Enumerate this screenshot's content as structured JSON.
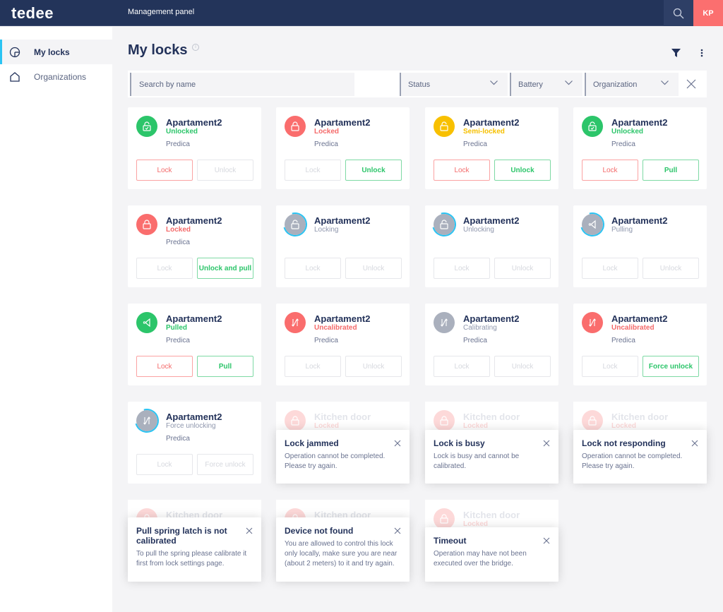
{
  "header": {
    "logo": "tedee",
    "title": "Management panel",
    "avatar_initials": "KP"
  },
  "sidebar": {
    "items": [
      {
        "label": "My locks",
        "icon": "lock-dial-icon",
        "active": true
      },
      {
        "label": "Organizations",
        "icon": "home-icon",
        "active": false
      }
    ]
  },
  "page": {
    "title": "My locks"
  },
  "filters": {
    "search_placeholder": "Search by name",
    "status": "Status",
    "battery": "Battery",
    "organization": "Organization"
  },
  "cards": [
    {
      "name": "Apartament2",
      "status": "Unlocked",
      "org": "Predica",
      "btn1": "Lock",
      "btn2": "Unlock"
    },
    {
      "name": "Apartament2",
      "status": "Locked",
      "org": "Predica",
      "btn1": "Lock",
      "btn2": "Unlock"
    },
    {
      "name": "Apartament2",
      "status": "Semi-locked",
      "org": "Predica",
      "btn1": "Lock",
      "btn2": "Unlock"
    },
    {
      "name": "Apartament2",
      "status": "Unlocked",
      "org": "Predica",
      "btn1": "Lock",
      "btn2": "Pull"
    },
    {
      "name": "Apartament2",
      "status": "Locked",
      "org": "Predica",
      "btn1": "Lock",
      "btn2": "Unlock and pull"
    },
    {
      "name": "Apartament2",
      "status": "Locking",
      "org": "",
      "btn1": "Lock",
      "btn2": "Unlock"
    },
    {
      "name": "Apartament2",
      "status": "Unlocking",
      "org": "",
      "btn1": "Lock",
      "btn2": "Unlock"
    },
    {
      "name": "Apartament2",
      "status": "Pulling",
      "org": "",
      "btn1": "Lock",
      "btn2": "Unlock"
    },
    {
      "name": "Apartament2",
      "status": "Pulled",
      "org": "Predica",
      "btn1": "Lock",
      "btn2": "Pull"
    },
    {
      "name": "Apartament2",
      "status": "Uncalibrated",
      "org": "Predica",
      "btn1": "Lock",
      "btn2": "Unlock"
    },
    {
      "name": "Apartament2",
      "status": "Calibrating",
      "org": "Predica",
      "btn1": "Lock",
      "btn2": "Unlock"
    },
    {
      "name": "Apartament2",
      "status": "Uncalibrated",
      "org": "Predica",
      "btn1": "Lock",
      "btn2": "Force unlock"
    },
    {
      "name": "Apartament2",
      "status": "Force unlocking",
      "org": "Predica",
      "btn1": "Lock",
      "btn2": "Force unlock"
    }
  ],
  "error_cards": [
    {
      "name": "Kitchen door",
      "status": "Locked",
      "title": "Lock jammed",
      "message": "Operation cannot be completed. Please try again."
    },
    {
      "name": "Kitchen door",
      "status": "Locked",
      "title": "Lock is busy",
      "message": "Lock is busy and cannot be calibrated."
    },
    {
      "name": "Kitchen door",
      "status": "Locked",
      "title": "Lock not responding",
      "message": "Operation cannot be completed. Please try again."
    },
    {
      "name": "Kitchen door",
      "status": "Locked",
      "title": "Pull spring latch is not calibrated",
      "message": "To pull the spring please calibrate it first from lock settings page."
    },
    {
      "name": "Kitchen door",
      "status": "Locked",
      "title": "Device not found",
      "message": "You are allowed to control this lock only locally, make sure you are near (about 2 meters) to it and try again."
    },
    {
      "name": "Kitchen door",
      "status": "Locked",
      "title": "Timeout",
      "message": "Operation may have not been executed over the bridge."
    }
  ],
  "colors": {
    "navy": "#23345a",
    "green": "#2cc56a",
    "red": "#fa6d6d",
    "yellow": "#f8c000",
    "grey": "#aab0bd",
    "accent": "#2bc4f3"
  }
}
